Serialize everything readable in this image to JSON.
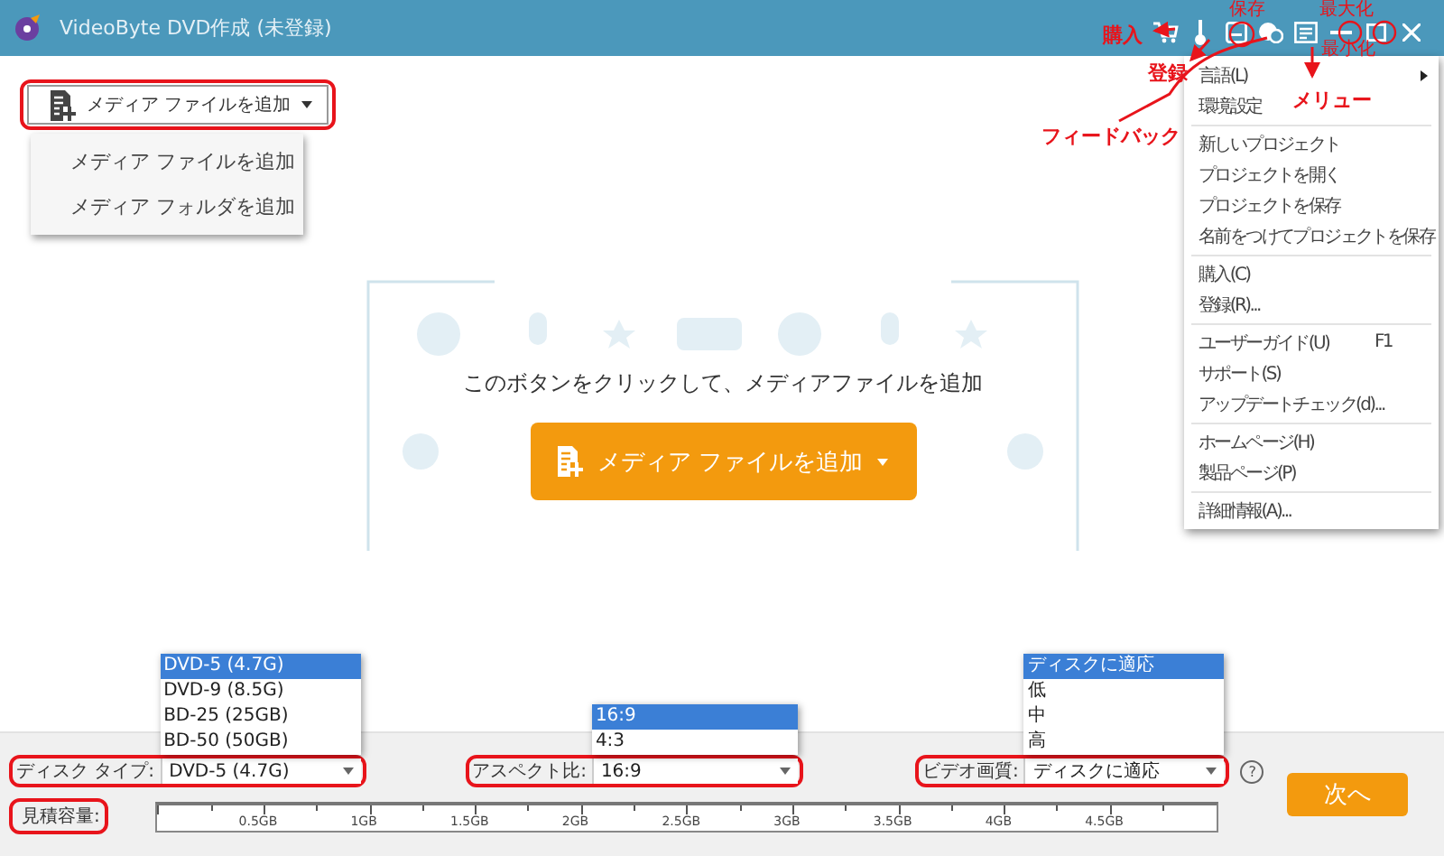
{
  "window": {
    "title": "VideoByte DVD作成 (未登録)"
  },
  "title_buttons": [
    {
      "kind": "cart"
    },
    {
      "kind": "key"
    },
    {
      "kind": "save"
    },
    {
      "kind": "feedback"
    },
    {
      "kind": "menu"
    },
    {
      "kind": "minimize"
    },
    {
      "kind": "maximize"
    },
    {
      "kind": "close"
    }
  ],
  "annotations": [
    "購入",
    "登録",
    "保存",
    "最大化",
    "最小化",
    "メリュー",
    "フィードバック"
  ],
  "add_media": {
    "label": "メディア ファイルを追加",
    "menu": [
      "メディア ファイルを追加",
      "メディア フォルダを追加"
    ]
  },
  "drop_zone": {
    "hint": "このボタンをクリックして、メディアファイルを追加",
    "button": "メディア ファイルを追加"
  },
  "app_menu": {
    "groups": [
      [
        {
          "label": "言語(L)",
          "kind": "submenu"
        },
        {
          "label": "環境設定",
          "kind": "item"
        }
      ],
      [
        {
          "label": "新しいプロジェクト",
          "kind": "item"
        },
        {
          "label": "プロジェクトを開く",
          "kind": "item"
        },
        {
          "label": "プロジェクトを保存",
          "kind": "item"
        },
        {
          "label": "名前をつけてプロジェクトを保存",
          "kind": "item"
        }
      ],
      [
        {
          "label": "購入(C)",
          "kind": "item"
        },
        {
          "label": "登録(R)...",
          "kind": "item"
        }
      ],
      [
        {
          "label": "ユーザーガイド(U)",
          "kind": "item",
          "shortcut": "F1"
        },
        {
          "label": "サポート(S)",
          "kind": "item"
        },
        {
          "label": "アップデートチェック(d)...",
          "kind": "item"
        }
      ],
      [
        {
          "label": "ホームページ(H)",
          "kind": "item"
        },
        {
          "label": "製品ページ(P)",
          "kind": "item"
        }
      ],
      [
        {
          "label": "詳細情報(A)...",
          "kind": "item"
        }
      ]
    ]
  },
  "selectors": [
    {
      "label": "ディスク タイプ:",
      "value": "DVD-5 (4.7G)",
      "options": [
        {
          "label": "DVD-5 (4.7G)",
          "selected": true
        },
        {
          "label": "DVD-9 (8.5G)",
          "selected": false
        },
        {
          "label": "BD-25 (25GB)",
          "selected": false
        },
        {
          "label": "BD-50 (50GB)",
          "selected": false
        }
      ]
    },
    {
      "label": "アスペクト比:",
      "value": "16:9",
      "options": [
        {
          "label": "16:9",
          "selected": true
        },
        {
          "label": "4:3",
          "selected": false
        }
      ]
    },
    {
      "label": "ビデオ画質:",
      "value": "ディスクに適応",
      "options": [
        {
          "label": "ディスクに適応",
          "selected": true
        },
        {
          "label": "低",
          "selected": false
        },
        {
          "label": "中",
          "selected": false
        },
        {
          "label": "高",
          "selected": false
        }
      ]
    }
  ],
  "help": "?",
  "capacity": {
    "label": "見積容量:",
    "ticks": [
      "0.5GB",
      "1GB",
      "1.5GB",
      "2GB",
      "2.5GB",
      "3GB",
      "3.5GB",
      "4GB",
      "4.5GB"
    ]
  },
  "next_button": "次へ"
}
